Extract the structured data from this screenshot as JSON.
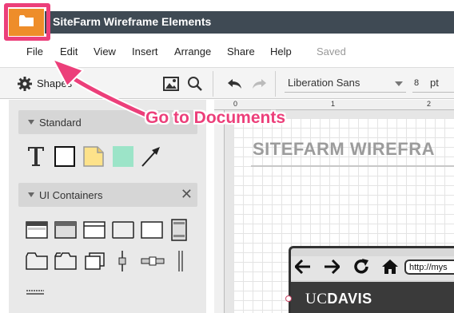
{
  "app": {
    "title": "SiteFarm Wireframe Elements",
    "accent_color": "#ee8d2a",
    "titlebar_color": "#3f4a54",
    "logo_icon": "folder-icon"
  },
  "menu": {
    "items": [
      "File",
      "Edit",
      "View",
      "Insert",
      "Arrange",
      "Share",
      "Help"
    ],
    "status": "Saved"
  },
  "toolbar": {
    "shapes_label": "Shapes",
    "font_family": "Liberation Sans",
    "font_size": "8",
    "font_unit": "pt",
    "icons": [
      "gear-icon",
      "image-icon",
      "search-icon",
      "undo-icon",
      "redo-icon"
    ]
  },
  "panel": {
    "sections": [
      {
        "label": "Standard",
        "shapes": [
          "text-shape",
          "rectangle-shape",
          "note-shape",
          "green-block-shape",
          "arrow-line-shape"
        ]
      },
      {
        "label": "UI Containers",
        "shapes": [
          "browser-window",
          "browser-window-gray",
          "window",
          "panel",
          "panel-alt",
          "scroll-list",
          "tab-folder",
          "tab-folder-2",
          "stacked-windows",
          "vertical-slider",
          "horizontal-slider",
          "vertical-splitter",
          "horizontal-splitter"
        ]
      }
    ]
  },
  "ruler": {
    "labels": [
      "0",
      "1",
      "2"
    ]
  },
  "canvas": {
    "heading": "SITEFARM WIREFRA",
    "url_text": "http://mys",
    "brand_uc": "UC",
    "brand_davis": "DAVIS",
    "browser_icons": [
      "back-arrow-icon",
      "forward-arrow-icon",
      "refresh-icon",
      "home-icon"
    ]
  },
  "annotation": {
    "text": "Go to Documents",
    "color": "#ec3f7a"
  }
}
